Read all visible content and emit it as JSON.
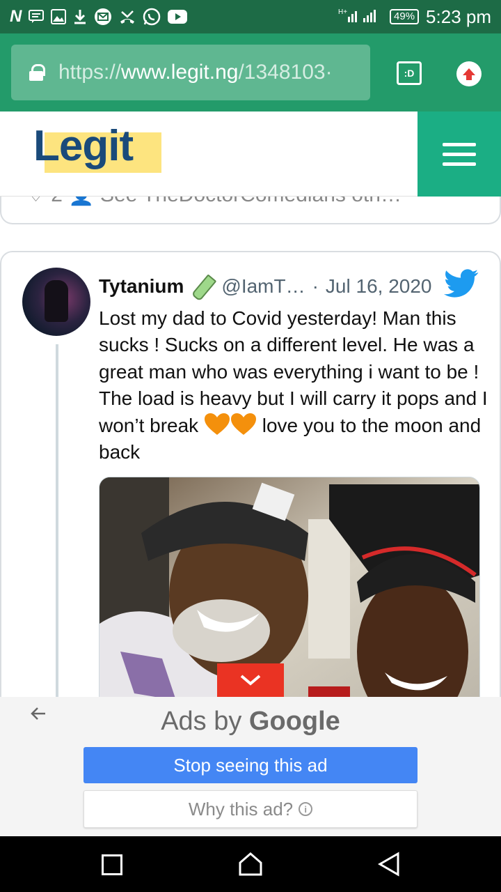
{
  "status_bar": {
    "time": "5:23 pm",
    "battery": "49%",
    "icons": [
      "news-icon",
      "message-icon",
      "image-icon",
      "download-icon",
      "mail-icon",
      "missed-call-icon",
      "whatsapp-icon",
      "youtube-icon"
    ],
    "signal": "H+",
    "n_icon_label": "N"
  },
  "browser": {
    "url_scheme": "https://",
    "url_host": "www.legit.ng",
    "url_path": "/1348103·",
    "tab_label": ":D"
  },
  "site": {
    "logo": "Legit",
    "accent": "#1bae84"
  },
  "prev_card": {
    "remnant": "♡  2      👤  See TheDoctorComedians oth…"
  },
  "tweet": {
    "name": "Tytanium",
    "handle": "@IamT…",
    "separator": "·",
    "date": "Jul 16, 2020",
    "text_before_emoji": "Lost my dad to Covid yesterday! Man this sucks ! Sucks on a different level. He was a great man who was everything i want to be ! The load is heavy but I will carry it pops and I won’t break ",
    "text_after_emoji": " love you to the moon and back"
  },
  "ad": {
    "ads_by": "Ads by ",
    "google": "Google",
    "stop_label": "Stop seeing this ad",
    "why_label": "Why this ad?",
    "info_glyph": "i"
  }
}
